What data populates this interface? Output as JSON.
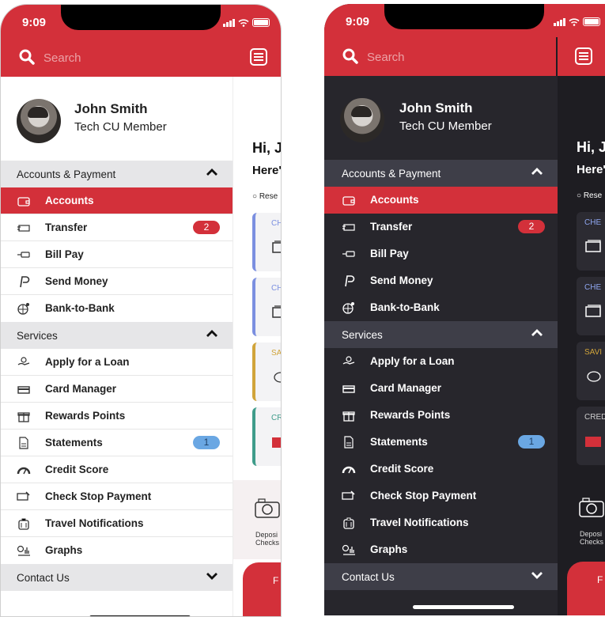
{
  "status": {
    "time": "9:09"
  },
  "search": {
    "placeholder": "Search"
  },
  "profile": {
    "name": "John Smith",
    "role": "Tech CU Member"
  },
  "sections": {
    "accounts_payment": "Accounts & Payment",
    "services": "Services",
    "contact": "Contact Us"
  },
  "items": {
    "accounts": "Accounts",
    "transfer": "Transfer",
    "bill_pay": "Bill Pay",
    "send_money": "Send Money",
    "bank_to_bank": "Bank-to-Bank",
    "apply_loan": "Apply for a Loan",
    "card_manager": "Card Manager",
    "rewards": "Rewards Points",
    "statements": "Statements",
    "credit_score": "Credit Score",
    "check_stop": "Check Stop Payment",
    "travel": "Travel Notifications",
    "graphs": "Graphs"
  },
  "badges": {
    "transfer": "2",
    "statements": "1"
  },
  "background_screen": {
    "greeting": "Hi, J",
    "subtitle": "Here'",
    "reset": "Rese",
    "cards": [
      {
        "label": "CHE",
        "accent": "#7b8fe0"
      },
      {
        "label": "CHE",
        "accent": "#7b8fe0"
      },
      {
        "label": "SAVI",
        "accent": "#d1a43a"
      },
      {
        "label": "CRED",
        "accent": "#3f9c8a"
      }
    ],
    "deposit_label_1": "Deposi",
    "deposit_label_2": "Checks",
    "fab_label": "F"
  },
  "colors": {
    "brand_red": "#d3303a",
    "dark_bg": "#27262c",
    "dark_section": "#3e3e48",
    "light_section": "#e6e6e8"
  }
}
